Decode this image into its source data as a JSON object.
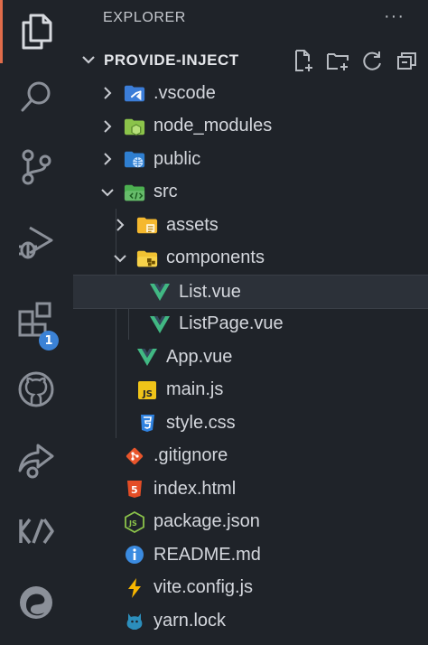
{
  "activity_bar": [
    {
      "name": "explorer-icon",
      "active": true
    },
    {
      "name": "search-icon"
    },
    {
      "name": "source-control-icon"
    },
    {
      "name": "run-debug-icon"
    },
    {
      "name": "extensions-icon",
      "badge": "1"
    },
    {
      "name": "github-icon"
    },
    {
      "name": "live-share-icon"
    },
    {
      "name": "code-icon"
    },
    {
      "name": "edge-icon"
    }
  ],
  "explorer": {
    "title": "EXPLORER",
    "more": "···",
    "section_title": "PROVIDE-INJECT",
    "actions": [
      "new-file-icon",
      "new-folder-icon",
      "refresh-icon",
      "collapse-all-icon"
    ]
  },
  "tree": [
    {
      "label": ".vscode",
      "icon": "vscode-folder-icon",
      "type": "folder",
      "expanded": false,
      "depth": 0
    },
    {
      "label": "node_modules",
      "icon": "node-folder-icon",
      "type": "folder",
      "expanded": false,
      "depth": 0
    },
    {
      "label": "public",
      "icon": "public-folder-icon",
      "type": "folder",
      "expanded": false,
      "depth": 0
    },
    {
      "label": "src",
      "icon": "src-folder-icon",
      "type": "folder",
      "expanded": true,
      "depth": 0
    },
    {
      "label": "assets",
      "icon": "assets-folder-icon",
      "type": "folder",
      "expanded": false,
      "depth": 1
    },
    {
      "label": "components",
      "icon": "components-folder-icon",
      "type": "folder",
      "expanded": true,
      "depth": 1
    },
    {
      "label": "List.vue",
      "icon": "vue-icon",
      "type": "file",
      "depth": 2,
      "selected": true
    },
    {
      "label": "ListPage.vue",
      "icon": "vue-icon",
      "type": "file",
      "depth": 2
    },
    {
      "label": "App.vue",
      "icon": "vue-icon",
      "type": "file",
      "depth": 1
    },
    {
      "label": "main.js",
      "icon": "js-icon",
      "type": "file",
      "depth": 1
    },
    {
      "label": "style.css",
      "icon": "css-icon",
      "type": "file",
      "depth": 1
    },
    {
      "label": ".gitignore",
      "icon": "git-icon",
      "type": "file",
      "depth": 0
    },
    {
      "label": "index.html",
      "icon": "html-icon",
      "type": "file",
      "depth": 0
    },
    {
      "label": "package.json",
      "icon": "nodejs-icon",
      "type": "file",
      "depth": 0
    },
    {
      "label": "README.md",
      "icon": "info-icon",
      "type": "file",
      "depth": 0
    },
    {
      "label": "vite.config.js",
      "icon": "vite-icon",
      "type": "file",
      "depth": 0
    },
    {
      "label": "yarn.lock",
      "icon": "yarn-icon",
      "type": "file",
      "depth": 0
    }
  ],
  "colors": {
    "background": "#1f2329",
    "accent": "#e06c4a",
    "selected_row": "#2c3139",
    "badge": "#3b82d6",
    "text": "#d4d7dd"
  }
}
